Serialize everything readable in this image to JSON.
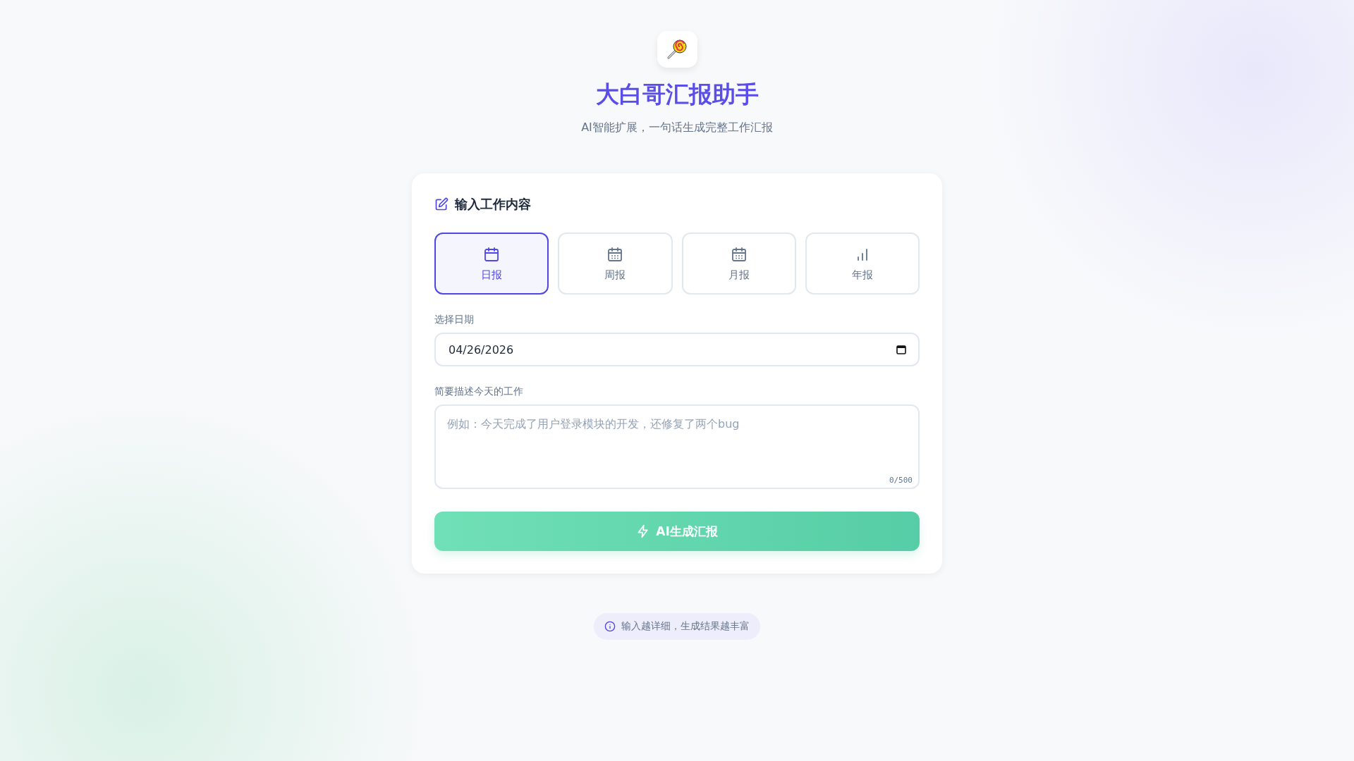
{
  "header": {
    "title": "大白哥汇报助手",
    "subtitle": "AI智能扩展，一句话生成完整工作汇报"
  },
  "card": {
    "heading": "输入工作内容",
    "tabs": [
      {
        "label": "日报",
        "kind": "calendar",
        "selected": true
      },
      {
        "label": "周报",
        "kind": "calendar-grid",
        "selected": false
      },
      {
        "label": "月报",
        "kind": "calendar-grid",
        "selected": false
      },
      {
        "label": "年报",
        "kind": "chart",
        "selected": false
      }
    ],
    "date_label": "选择日期",
    "date_value": "04/26/2026",
    "work_label": "简要描述今天的工作",
    "work_placeholder": "例如：今天完成了用户登录模块的开发，还修复了两个bug",
    "counter": "0/500",
    "generate_button": {
      "label": "AI生成汇报",
      "disabled": true
    }
  },
  "tip": "输入越详细，生成结果越丰富"
}
